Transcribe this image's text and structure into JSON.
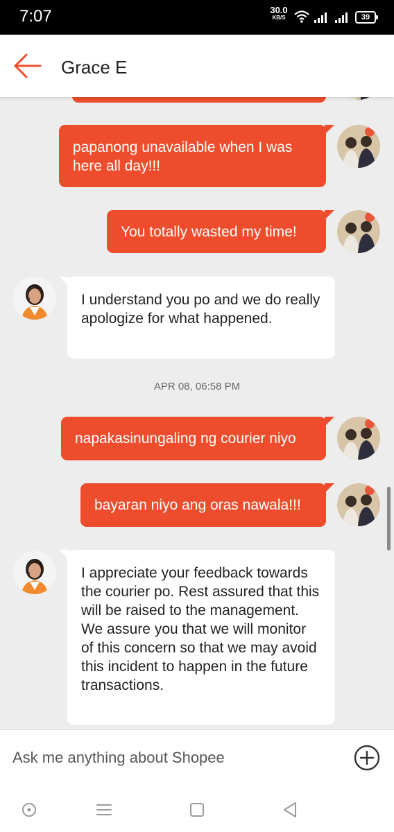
{
  "status_bar": {
    "time": "7:07",
    "net_speed": "30.0",
    "net_speed_unit": "KB/S",
    "battery": "39"
  },
  "header": {
    "title": "Grace E",
    "back_icon": "back-arrow-icon"
  },
  "messages": [
    {
      "sender": "me",
      "text": "papanong unavailable when I was here all day!!!"
    },
    {
      "sender": "me",
      "text": "You totally wasted my time!"
    },
    {
      "sender": "agent",
      "text": "I understand you po and we do really apologize for what happened."
    },
    {
      "sender": "me",
      "text": "napakasinungaling ng courier niyo"
    },
    {
      "sender": "me",
      "text": "bayaran niyo ang oras nawala!!!"
    },
    {
      "sender": "agent",
      "text": "I appreciate your feedback towards the courier po. Rest assured that this will be raised to the management. We assure you that we will monitor of this concern so that we may avoid this incident to happen in the future transactions."
    }
  ],
  "timestamp": "APR 08, 06:58 PM",
  "input": {
    "placeholder": "Ask me anything about Shopee"
  },
  "colors": {
    "brand": "#ee4d2d",
    "background": "#ededed"
  },
  "icons": {
    "add": "plus-circle-icon",
    "nav": [
      "home-circle-icon",
      "menu-icon",
      "square-icon",
      "back-triangle-icon"
    ]
  }
}
